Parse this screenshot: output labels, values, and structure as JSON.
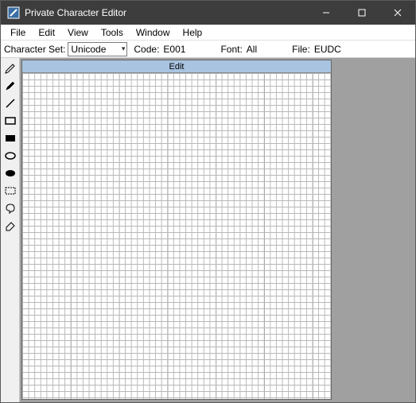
{
  "titlebar": {
    "title": "Private Character Editor"
  },
  "menubar": {
    "items": [
      "File",
      "Edit",
      "View",
      "Tools",
      "Window",
      "Help"
    ]
  },
  "infobar": {
    "charset_label": "Character Set:",
    "charset_value": "Unicode",
    "code_label": "Code:",
    "code_value": "E001",
    "font_label": "Font:",
    "font_value": "All",
    "file_label": "File:",
    "file_value": "EUDC"
  },
  "canvas": {
    "title": "Edit"
  },
  "tools": [
    {
      "name": "pencil-tool",
      "icon": "pencil"
    },
    {
      "name": "brush-tool",
      "icon": "brush"
    },
    {
      "name": "line-tool",
      "icon": "line"
    },
    {
      "name": "rectangle-outline-tool",
      "icon": "rect-outline"
    },
    {
      "name": "rectangle-fill-tool",
      "icon": "rect-fill"
    },
    {
      "name": "ellipse-outline-tool",
      "icon": "ellipse-outline"
    },
    {
      "name": "ellipse-fill-tool",
      "icon": "ellipse-fill"
    },
    {
      "name": "rect-select-tool",
      "icon": "rect-select"
    },
    {
      "name": "freeform-select-tool",
      "icon": "freeform-select"
    },
    {
      "name": "eraser-tool",
      "icon": "eraser"
    }
  ]
}
